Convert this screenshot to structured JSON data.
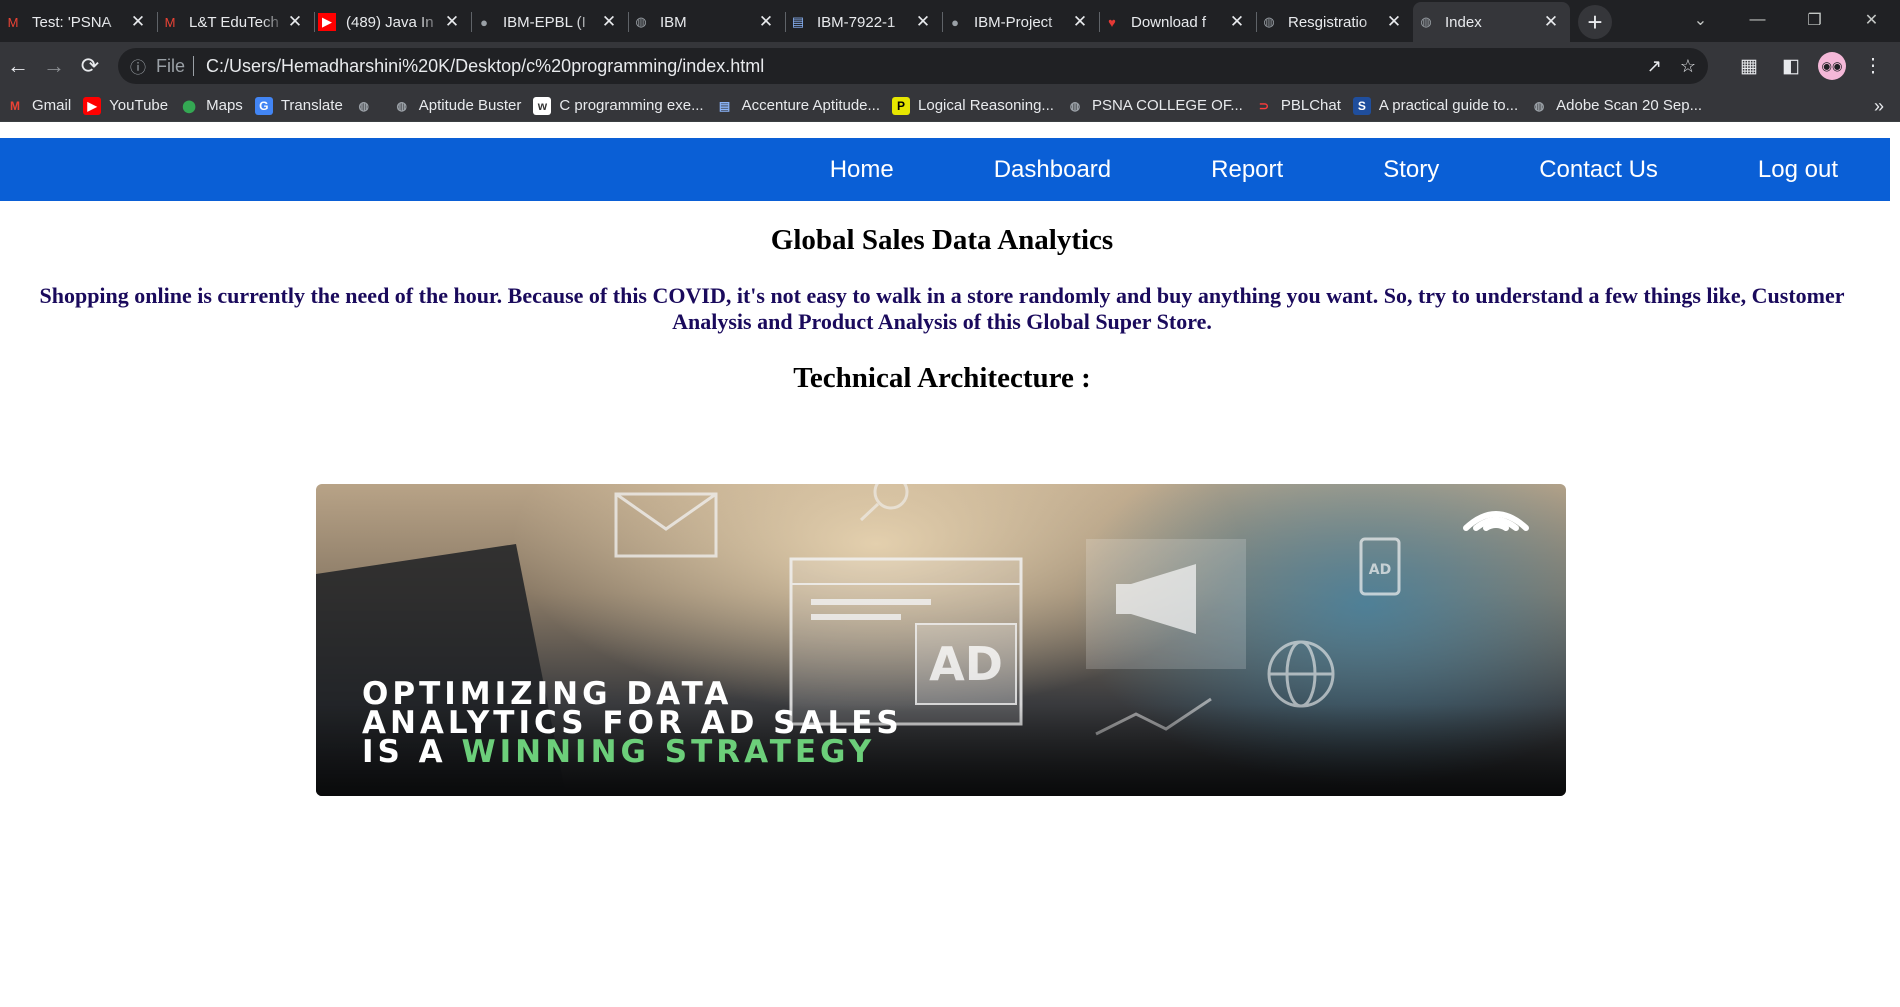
{
  "browser": {
    "tabs": [
      {
        "title": "Test: 'PSNA",
        "icon": "gmail-icon",
        "active": false
      },
      {
        "title": "L&T EduTech",
        "icon": "gmail-icon",
        "active": false
      },
      {
        "title": "(489) Java In",
        "icon": "youtube-icon",
        "active": false
      },
      {
        "title": "IBM-EPBL (I",
        "icon": "github-icon",
        "active": false
      },
      {
        "title": "IBM",
        "icon": "globe-icon",
        "active": false
      },
      {
        "title": "IBM-7922-1",
        "icon": "doc-icon",
        "active": false
      },
      {
        "title": "IBM-Project",
        "icon": "github-icon",
        "active": false
      },
      {
        "title": "Download f",
        "icon": "heart-icon",
        "active": false
      },
      {
        "title": "Resgistratio",
        "icon": "globe-icon",
        "active": false
      },
      {
        "title": "Index",
        "icon": "globe-icon",
        "active": true
      }
    ],
    "address": {
      "scheme": "File",
      "url": "C:/Users/Hemadharshini%20K/Desktop/c%20programming/index.html"
    },
    "bookmarks": [
      {
        "label": "Gmail",
        "icon": "gmail-icon",
        "color": "#ea4335"
      },
      {
        "label": "YouTube",
        "icon": "youtube-icon",
        "color": "#ff0000"
      },
      {
        "label": "Maps",
        "icon": "maps-icon",
        "color": "#34a853"
      },
      {
        "label": "Translate",
        "icon": "translate-icon",
        "color": "#4285f4"
      },
      {
        "label": "",
        "icon": "globe-icon",
        "color": "#9aa0a6"
      },
      {
        "label": "Aptitude Buster",
        "icon": "globe-icon",
        "color": "#9aa0a6"
      },
      {
        "label": "C programming exe...",
        "icon": "w3r-icon",
        "color": "#ffffff"
      },
      {
        "label": "Accenture Aptitude...",
        "icon": "doc-icon",
        "color": "#ffffff"
      },
      {
        "label": "Logical Reasoning...",
        "icon": "p-icon",
        "color": "#e6e600"
      },
      {
        "label": "PSNA COLLEGE OF...",
        "icon": "globe-icon",
        "color": "#9aa0a6"
      },
      {
        "label": "PBLChat",
        "icon": "pbl-icon",
        "color": "#ff3b3b"
      },
      {
        "label": "A practical guide to...",
        "icon": "s-icon",
        "color": "#1f4e9d"
      },
      {
        "label": "Adobe Scan 20 Sep...",
        "icon": "globe-icon",
        "color": "#9aa0a6"
      }
    ]
  },
  "nav": {
    "links": [
      "Home",
      "Dashboard",
      "Report",
      "Story",
      "Contact Us",
      "Log out"
    ],
    "bg_color": "#0a5fd6"
  },
  "page": {
    "title": "Global Sales Data Analytics",
    "intro": "Shopping online is currently the need of the hour. Because of this COVID, it's not easy to walk in a store randomly and buy anything you want. So, try to understand a few things like, Customer Analysis and Product Analysis of this Global Super Store.",
    "section_title": "Technical Architecture :",
    "banner": {
      "line1": "OPTIMIZING DATA",
      "line2": "ANALYTICS FOR AD SALES",
      "line3_prefix": "IS A ",
      "line3_highlight": "WINNING STRATEGY",
      "ad_label": "AD"
    }
  }
}
